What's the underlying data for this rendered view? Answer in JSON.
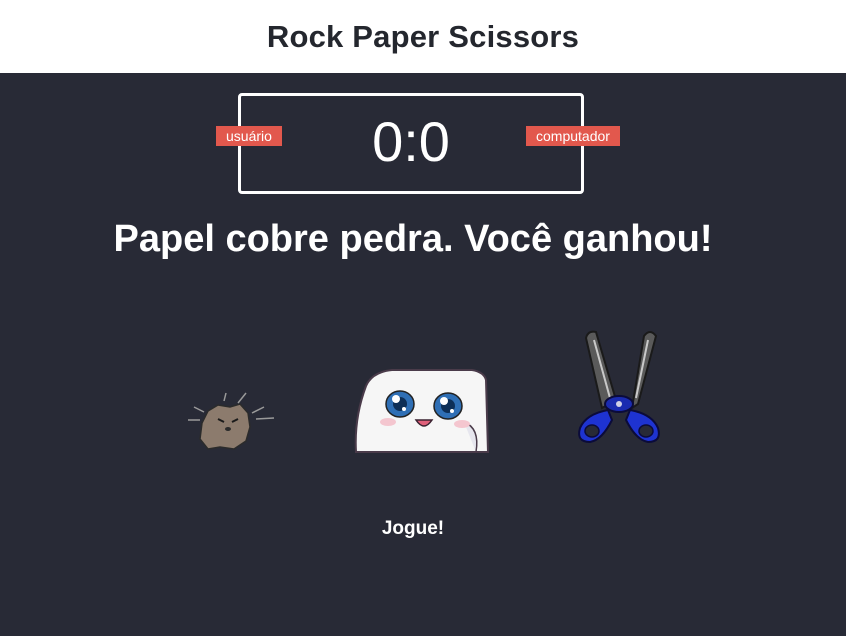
{
  "header": {
    "title": "Rock Paper Scissors"
  },
  "scoreboard": {
    "user_label": "usuário",
    "computer_label": "computador",
    "score": "0:0"
  },
  "result_message": "Papel cobre pedra. Você ganhou!",
  "choices": [
    {
      "id": "rock",
      "icon": "rock-icon"
    },
    {
      "id": "paper",
      "icon": "paper-icon"
    },
    {
      "id": "scissors",
      "icon": "scissors-icon"
    }
  ],
  "action_message": "Jogue!",
  "colors": {
    "background": "#282a36",
    "header_bg": "#ffffff",
    "badge": "#e2584d",
    "text": "#ffffff"
  }
}
